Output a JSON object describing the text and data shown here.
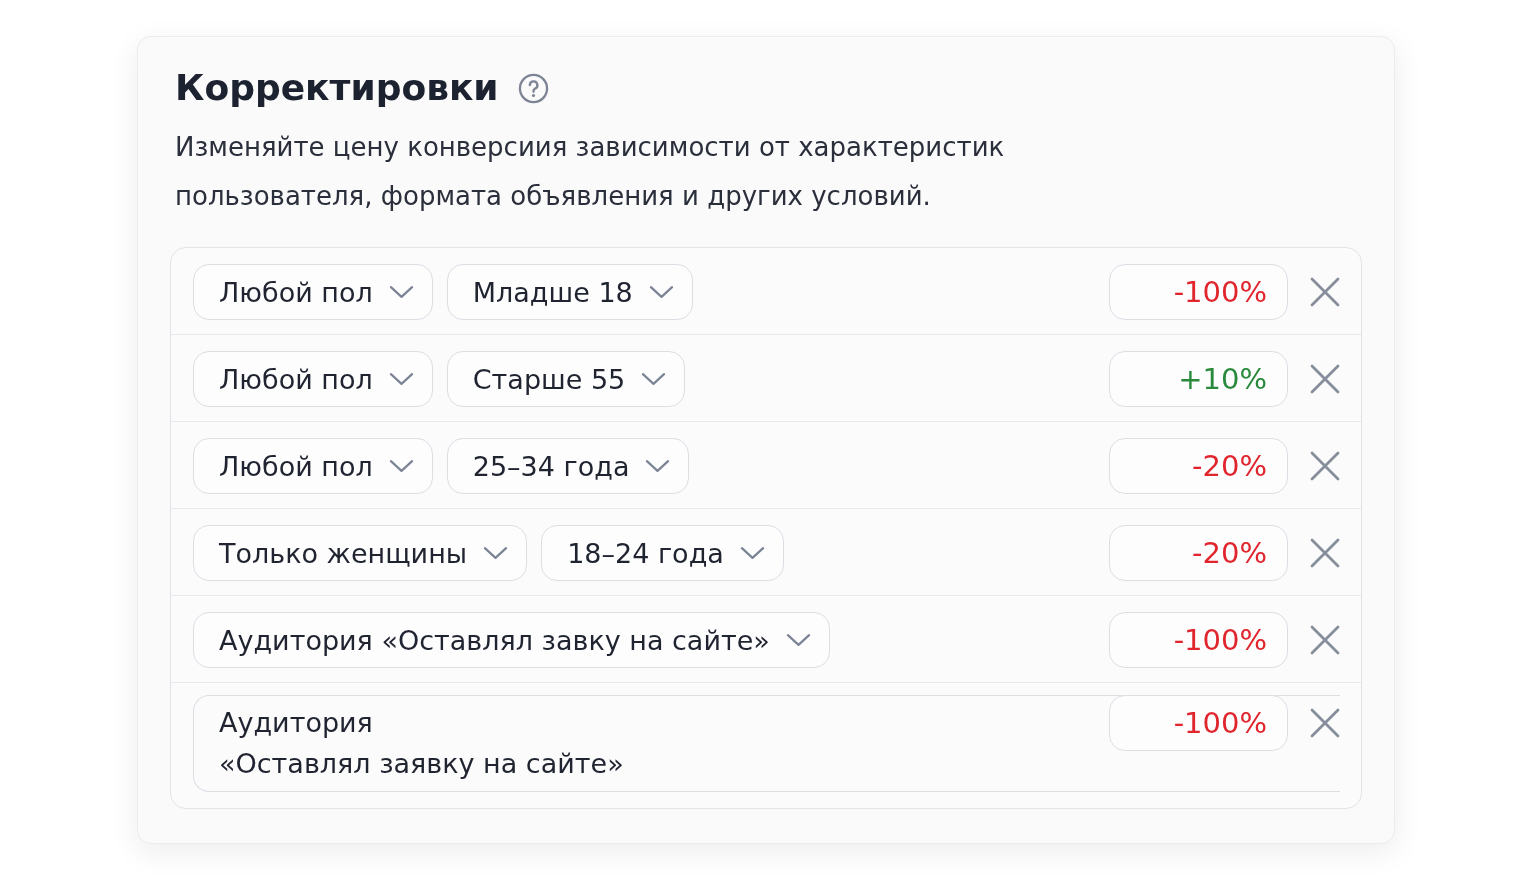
{
  "title": "Корректировки",
  "description": "Изменяйте цену конверсиия зависимости от характеристик пользователя, формата объявления и других условий.",
  "adjustments": [
    {
      "kind": "dropdowns",
      "conditions": [
        "Любой пол",
        "Младше 18"
      ],
      "value": "-100%",
      "color": "#e0252d"
    },
    {
      "kind": "dropdowns",
      "conditions": [
        "Любой пол",
        "Старше 55"
      ],
      "value": "+10%",
      "color": "#2a8a3c"
    },
    {
      "kind": "dropdowns",
      "conditions": [
        "Любой пол",
        "25–34 года"
      ],
      "value": "-20%",
      "color": "#e0252d"
    },
    {
      "kind": "dropdowns",
      "conditions": [
        "Только женщины",
        "18–24 года"
      ],
      "value": "-20%",
      "color": "#e0252d"
    },
    {
      "kind": "dropdowns",
      "conditions": [
        "Аудитория «Оставлял завку на сайте»"
      ],
      "value": "-100%",
      "color": "#e0252d"
    },
    {
      "kind": "text",
      "text": "Аудитория\n«Оставлял заявку на сайте»",
      "value": "-100%",
      "color": "#e0252d"
    }
  ]
}
